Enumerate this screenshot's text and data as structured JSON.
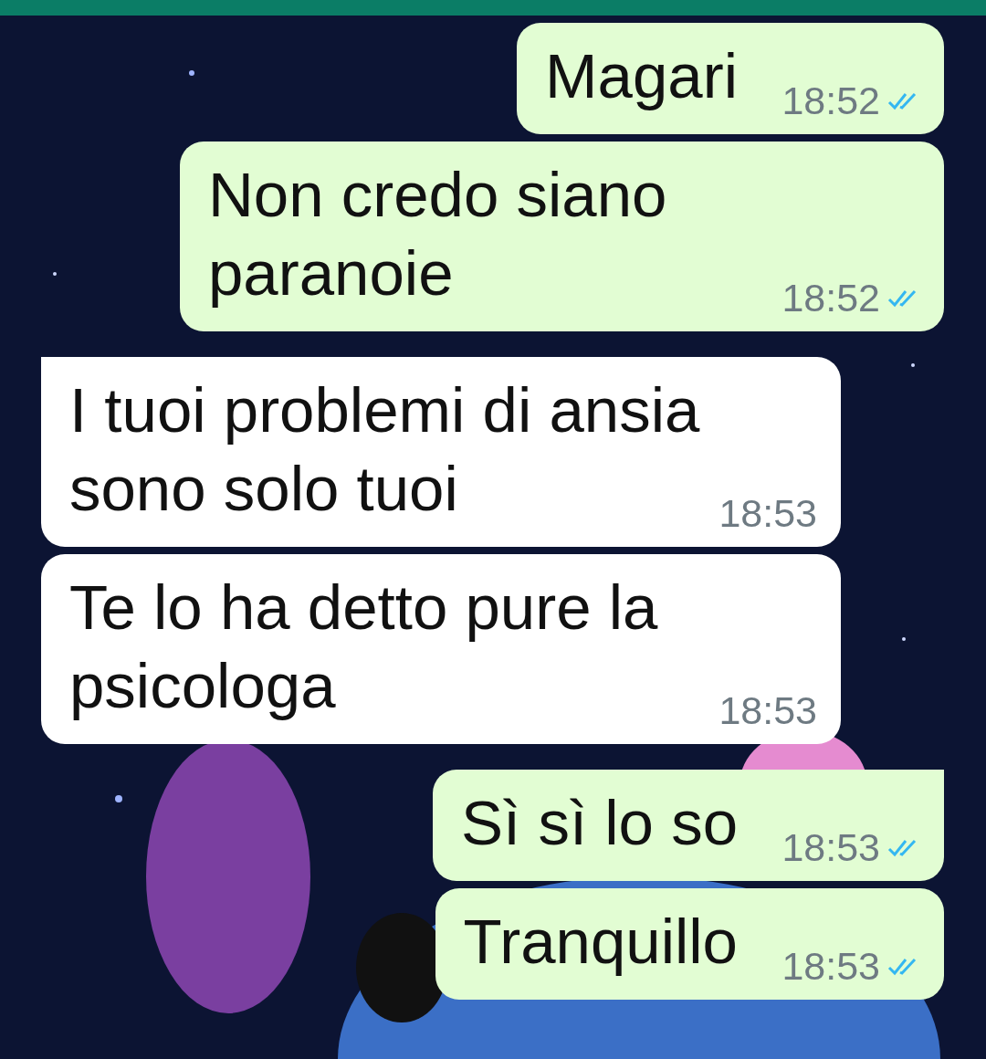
{
  "messages": [
    {
      "outgoing": true,
      "text": "Magari",
      "time": "18:52",
      "read": true,
      "tail": false
    },
    {
      "outgoing": true,
      "text": "Non credo siano paranoie",
      "time": "18:52",
      "read": true,
      "tail": false
    },
    {
      "outgoing": false,
      "text": "I tuoi problemi di ansia sono solo tuoi",
      "time": "18:53",
      "tail": true
    },
    {
      "outgoing": false,
      "text": "Te lo ha detto pure la psicologa",
      "time": "18:53",
      "tail": false
    },
    {
      "outgoing": true,
      "text": "Sì sì lo so",
      "time": "18:53",
      "read": true,
      "tail": true
    },
    {
      "outgoing": true,
      "text": "Tranquillo",
      "time": "18:53",
      "read": true,
      "tail": false
    }
  ]
}
